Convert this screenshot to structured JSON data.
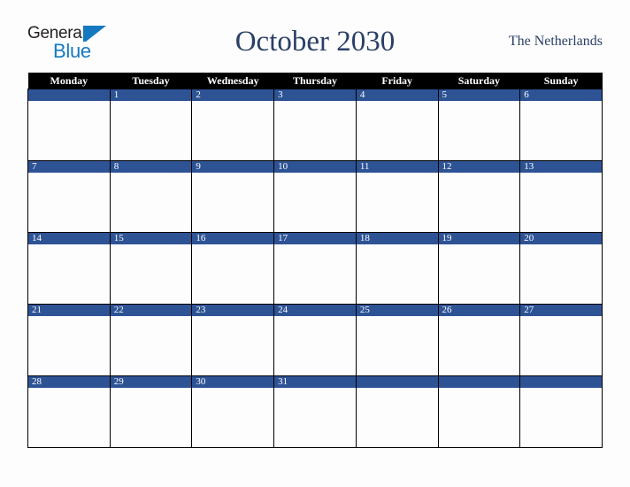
{
  "brand": {
    "name_part1": "General",
    "name_part2": "Blue",
    "triangle_icon": "triangle-icon",
    "color_dark": "#231f20",
    "color_blue": "#1579c0"
  },
  "header": {
    "title": "October 2030",
    "locale": "The Netherlands",
    "title_color": "#2a3f66"
  },
  "calendar": {
    "month": "October",
    "year": "2030",
    "weekday_headers": [
      "Monday",
      "Tuesday",
      "Wednesday",
      "Thursday",
      "Friday",
      "Saturday",
      "Sunday"
    ],
    "header_bg": "#000000",
    "header_text": "#ffffff",
    "daynum_bg": "#2e5395",
    "daynum_text": "#ffffff",
    "cell_bg": "#fdfdfd",
    "grid_line": "#000000",
    "weeks": [
      [
        "",
        "1",
        "2",
        "3",
        "4",
        "5",
        "6"
      ],
      [
        "7",
        "8",
        "9",
        "10",
        "11",
        "12",
        "13"
      ],
      [
        "14",
        "15",
        "16",
        "17",
        "18",
        "19",
        "20"
      ],
      [
        "21",
        "22",
        "23",
        "24",
        "25",
        "26",
        "27"
      ],
      [
        "28",
        "29",
        "30",
        "31",
        "",
        "",
        ""
      ]
    ]
  }
}
